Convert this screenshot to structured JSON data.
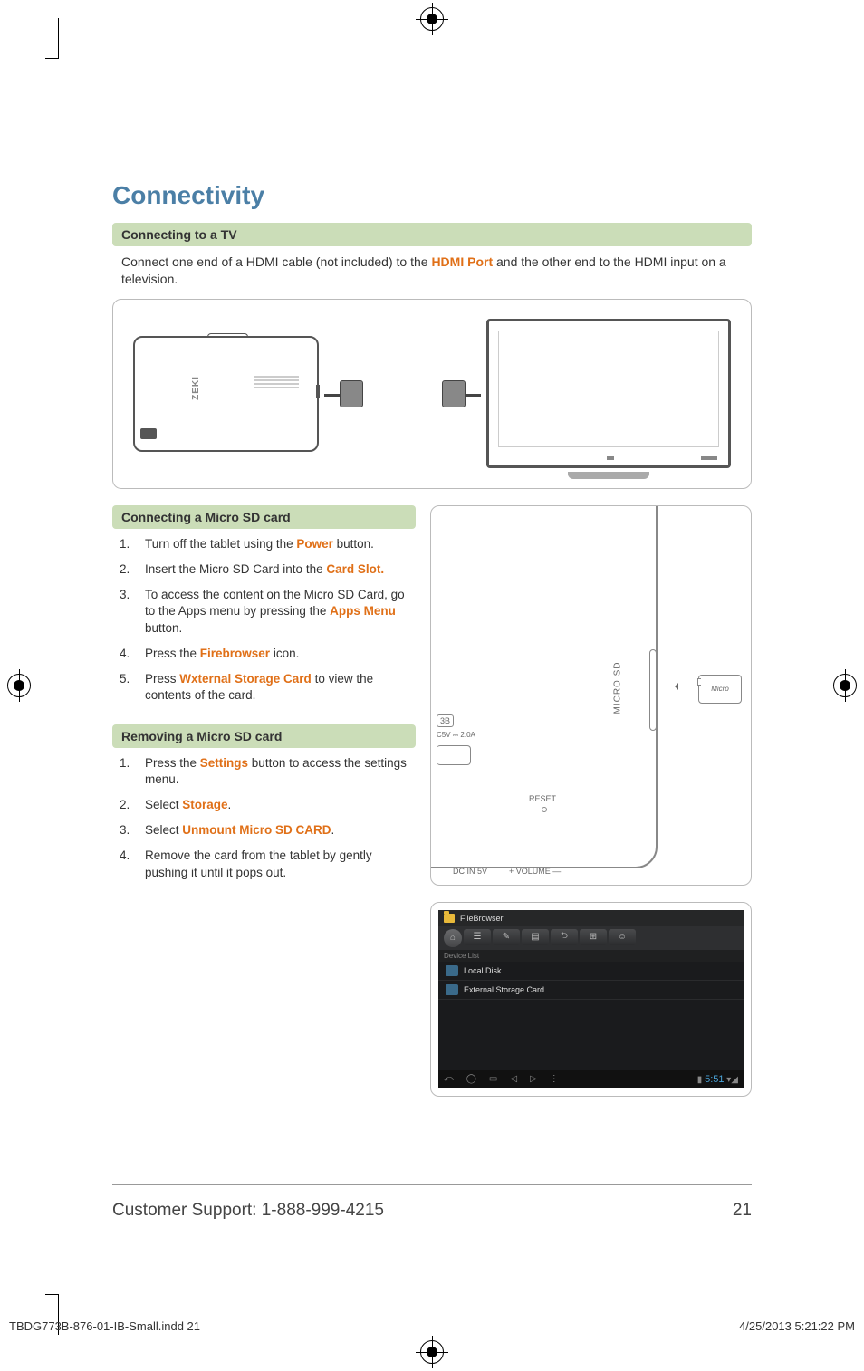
{
  "title": "Connectivity",
  "connecting_tv": {
    "heading": "Connecting to a TV",
    "intro_pre": "Connect one end of a HDMI cable (not included) to the ",
    "intro_hi": "HDMI Port",
    "intro_post": " and the other end to the HDMI input on a television.",
    "tablet_brand": "ZEKI"
  },
  "connecting_sd": {
    "heading": "Connecting a Micro SD card",
    "steps": [
      {
        "n": "1.",
        "pre": "Turn off the tablet using the ",
        "hi": "Power",
        "post": " button."
      },
      {
        "n": "2.",
        "pre": "Insert the Micro SD Card into the ",
        "hi": "Card Slot",
        "hi_post_punct": ".",
        "post": ""
      },
      {
        "n": "3.",
        "pre": "To access the content on the Micro SD Card, go to the Apps menu by pressing the ",
        "hi": "Apps Menu",
        "post": " button."
      },
      {
        "n": "4.",
        "pre": "Press the ",
        "hi": "Firebrowser",
        "post": " icon."
      },
      {
        "n": "5.",
        "pre": "Press ",
        "hi": "Wxternal Storage Card",
        "post": " to view the contents of the card."
      }
    ]
  },
  "removing_sd": {
    "heading": "Removing a Micro SD card",
    "steps": [
      {
        "n": "1.",
        "pre": "Press the ",
        "hi": "Settings",
        "post": " button to access the settings menu."
      },
      {
        "n": "2.",
        "pre": "Select ",
        "hi": "Storage",
        "post": "."
      },
      {
        "n": "3.",
        "pre": "Select ",
        "hi": "Unmount Micro SD CARD",
        "post": "."
      },
      {
        "n": "4.",
        "pre": "Remove the card from the tablet by gently pushing it until it pops out.",
        "hi": "",
        "post": ""
      }
    ]
  },
  "sd_diagram": {
    "micro_sd": "MICRO SD",
    "usb": "3B",
    "usb_sub": "C5V ⎓ 2.0A",
    "reset": "RESET",
    "dc": "DC IN 5V",
    "volume": "VOLUME —",
    "card_text": "Micro"
  },
  "screenshot": {
    "title": "FileBrowser",
    "section": "Device List",
    "row1": "Local Disk",
    "row2": "External Storage Card",
    "time": "5:51"
  },
  "footer": {
    "support": "Customer Support: 1-888-999-4215",
    "page": "21"
  },
  "slug": {
    "file": "TBDG773B-876-01-IB-Small.indd   21",
    "date": "4/25/2013   5:21:22 PM"
  }
}
